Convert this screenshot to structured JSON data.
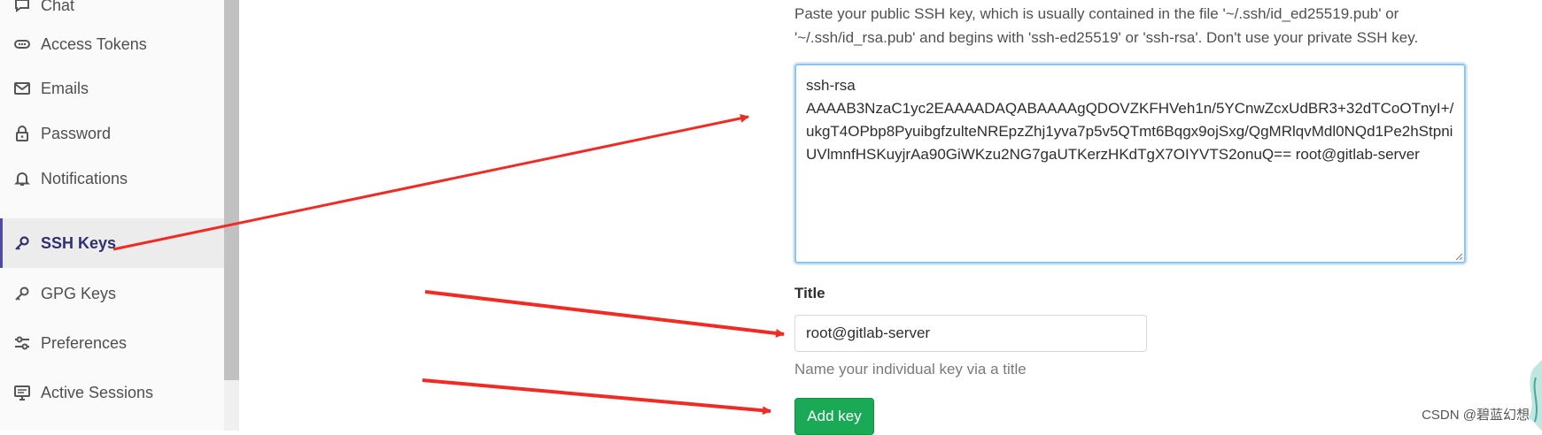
{
  "sidebar": {
    "items": [
      {
        "label": "Chat",
        "icon": "chat-icon"
      },
      {
        "label": "Access Tokens",
        "icon": "token-icon"
      },
      {
        "label": "Emails",
        "icon": "mail-icon"
      },
      {
        "label": "Password",
        "icon": "lock-icon"
      },
      {
        "label": "Notifications",
        "icon": "bell-icon"
      },
      {
        "label": "SSH Keys",
        "icon": "key-icon",
        "active": true
      },
      {
        "label": "GPG Keys",
        "icon": "key-icon"
      },
      {
        "label": "Preferences",
        "icon": "sliders-icon"
      },
      {
        "label": "Active Sessions",
        "icon": "monitor-icon"
      }
    ]
  },
  "form": {
    "help_text": "Paste your public SSH key, which is usually contained in the file '~/.ssh/id_ed25519.pub' or '~/.ssh/id_rsa.pub' and begins with 'ssh-ed25519' or 'ssh-rsa'. Don't use your private SSH key.",
    "key_value": "ssh-rsa\nAAAAB3NzaC1yc2EAAAADAQABAAAAgQDOVZKFHVeh1n/5YCnwZcxUdBR3+32dTCoOTnyI+/ukgT4OPbp8PyuibgfzulteNREpzZhj1yva7p5v5QTmt6Bqgx9ojSxg/QgMRlqvMdl0NQd1Pe2hStpniUVlmnfHSKuyjrAa90GiWKzu2NG7gaUTKerzHKdTgX7OIYVTS2onuQ== root@gitlab-server",
    "title_label": "Title",
    "title_value": "root@gitlab-server",
    "title_hint": "Name your individual key via a title",
    "add_key_label": "Add key"
  },
  "watermark": "CSDN @碧蓝幻想",
  "colors": {
    "accent_active": "#4b4ba3",
    "add_button": "#1aaa55",
    "arrow": "#ef2b24",
    "textarea_focus": "#8fc4ee"
  }
}
